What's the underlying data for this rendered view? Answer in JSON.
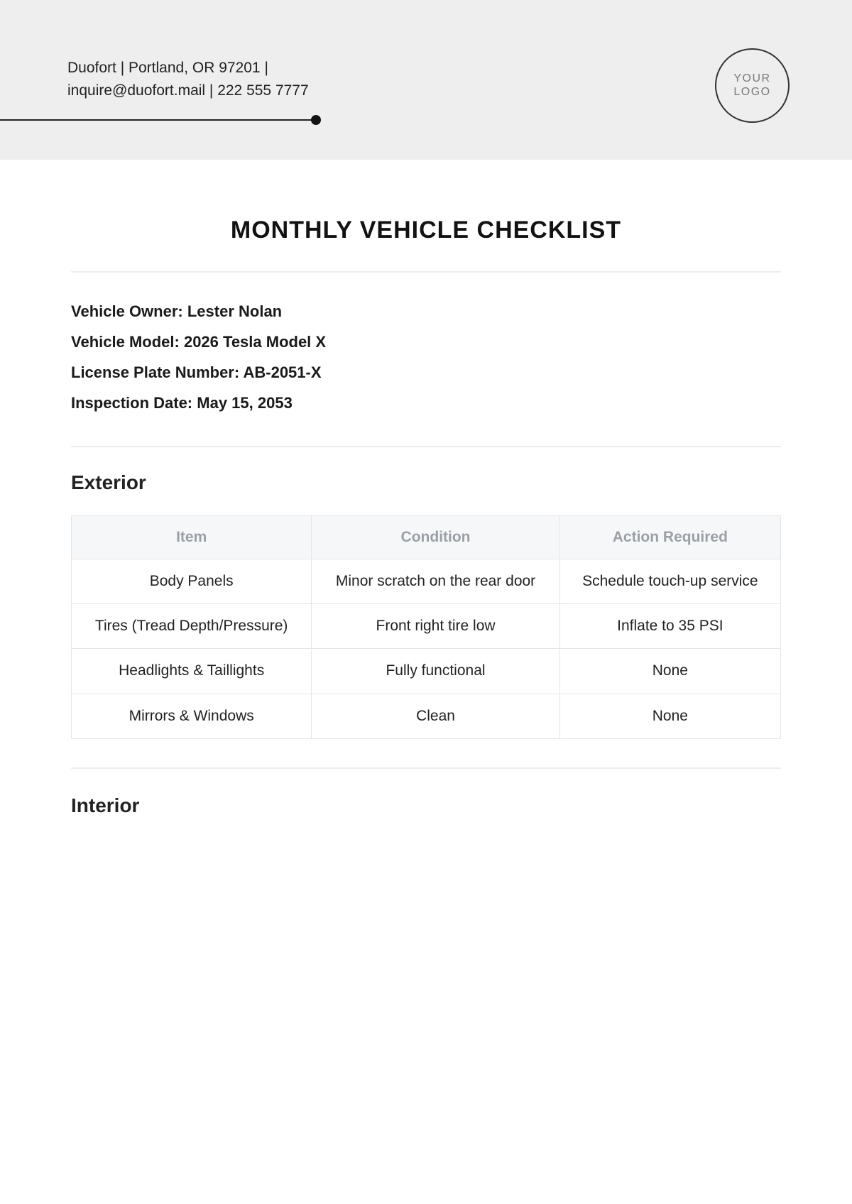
{
  "header": {
    "company_line1": "Duofort | Portland, OR 97201 |",
    "company_line2": "inquire@duofort.mail | 222 555 7777",
    "logo_line1": "YOUR",
    "logo_line2": "LOGO"
  },
  "title": "MONTHLY VEHICLE CHECKLIST",
  "info": {
    "owner_label": "Vehicle Owner:",
    "owner_value": "Lester Nolan",
    "model_label": "Vehicle Model:",
    "model_value": "2026 Tesla Model X",
    "plate_label": "License Plate Number:",
    "plate_value": "AB-2051-X",
    "date_label": "Inspection Date:",
    "date_value": "May 15, 2053"
  },
  "sections": {
    "exterior": {
      "heading": "Exterior",
      "columns": {
        "item": "Item",
        "condition": "Condition",
        "action": "Action Required"
      },
      "rows": [
        {
          "item": "Body Panels",
          "condition": "Minor scratch on the rear door",
          "action": "Schedule touch-up service"
        },
        {
          "item": "Tires (Tread Depth/Pressure)",
          "condition": "Front right tire low",
          "action": "Inflate to 35 PSI"
        },
        {
          "item": "Headlights & Taillights",
          "condition": "Fully functional",
          "action": "None"
        },
        {
          "item": "Mirrors & Windows",
          "condition": "Clean",
          "action": "None"
        }
      ]
    },
    "interior": {
      "heading": "Interior"
    }
  }
}
